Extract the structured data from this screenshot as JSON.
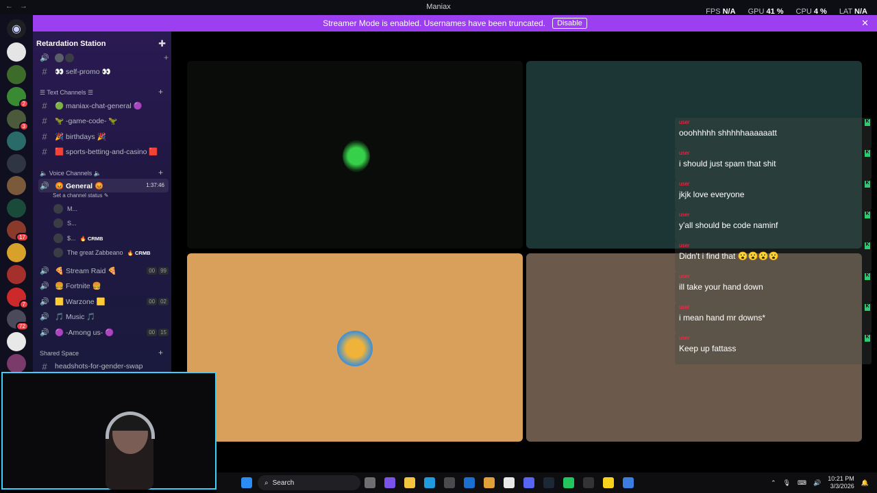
{
  "window": {
    "title": "Maniax",
    "back": "←",
    "forward": "→"
  },
  "stats": [
    {
      "label": "FPS",
      "value": "N/A"
    },
    {
      "label": "GPU",
      "value": "41 %"
    },
    {
      "label": "CPU",
      "value": "4 %"
    },
    {
      "label": "LAT",
      "value": "N/A"
    }
  ],
  "banner": {
    "text": "Streamer Mode is enabled. Usernames have been truncated.",
    "button": "Disable",
    "close": "✕"
  },
  "server": {
    "name": "Retardation Station",
    "add_icon": "person-add-icon"
  },
  "channels": {
    "top": {
      "name": "👀 self-promo 👀"
    },
    "text_category": "☰ Text Channels ☰",
    "text": [
      {
        "name": "🟢 maniax-chat-general 🟣"
      },
      {
        "name": "🦖 -game-code- 🦖"
      },
      {
        "name": "🎉 birthdays 🎉"
      },
      {
        "name": "🟥 sports-betting-and-casino 🟥"
      }
    ],
    "voice_category": "🔈 Voice Channels 🔈",
    "general": {
      "name": "😡 General 😡",
      "timer": "1:37:46",
      "status": "Set a channel status ✎"
    },
    "users": [
      {
        "name": "M..."
      },
      {
        "name": "S..."
      },
      {
        "name": "$...",
        "tag": "🔥 CRMB"
      },
      {
        "name": "The great Zabbeano",
        "tag": "🔥 CRMB"
      }
    ],
    "voice": [
      {
        "name": "🍕 Stream Raid 🍕",
        "count_a": "00",
        "count_b": "99"
      },
      {
        "name": "🍔 Fortnite 🍔"
      },
      {
        "name": "🟨 Warzone 🟨",
        "count_a": "00",
        "count_b": "02"
      },
      {
        "name": "🎵 Music 🎵"
      },
      {
        "name": "🟣 -Among us- 🟣",
        "count_a": "00",
        "count_b": "15"
      }
    ],
    "shared_category": "Shared Space",
    "shared": [
      {
        "name": "headshots-for-gender-swap"
      }
    ]
  },
  "guilds": [
    {
      "badge": ""
    },
    {
      "badge": ""
    },
    {
      "badge": "2"
    },
    {
      "badge": "3"
    },
    {
      "badge": ""
    },
    {
      "badge": ""
    },
    {
      "badge": ""
    },
    {
      "badge": ""
    },
    {
      "badge": "17"
    },
    {
      "badge": ""
    },
    {
      "badge": ""
    },
    {
      "badge": "7"
    },
    {
      "badge": "72"
    },
    {
      "badge": ""
    },
    {
      "badge": ""
    }
  ],
  "chat": [
    {
      "author": "user",
      "text": "ooohhhhh shhhhhaaaaaatt"
    },
    {
      "author": "user",
      "text": "i should just spam that shit"
    },
    {
      "author": "user",
      "text": "jkjk love everyone"
    },
    {
      "author": "user",
      "text": "y'all should be code naminf"
    },
    {
      "author": "user",
      "text": "Didn't i find that 😮😮😮😮"
    },
    {
      "author": "user",
      "text": "ill take your hand down"
    },
    {
      "author": "user",
      "text": "i mean hand mr downs*"
    },
    {
      "author": "user",
      "text": "Keep up fattass"
    }
  ],
  "taskbar": {
    "search_placeholder": "Search",
    "time": "10:21 PM",
    "date": "3/3/2026"
  },
  "colors": {
    "banner": "#9b3ff0",
    "tile_orange": "#d9a05c",
    "tile_teal": "#1b3635",
    "tile_brown": "#6b5a4b",
    "tile_dark": "#0a0c0a",
    "webcam_border": "#3bd1ff"
  }
}
